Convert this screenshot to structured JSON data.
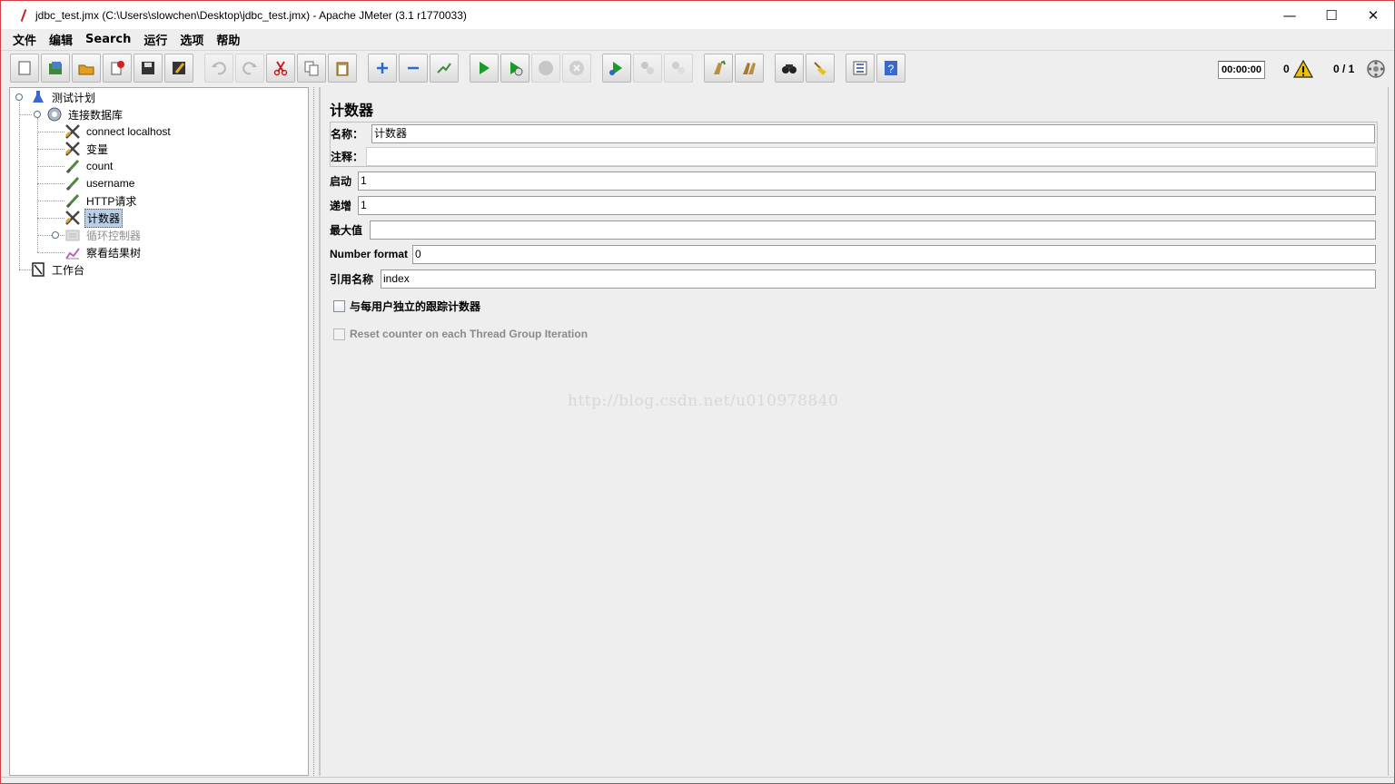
{
  "window": {
    "title": "jdbc_test.jmx (C:\\Users\\slowchen\\Desktop\\jdbc_test.jmx) - Apache JMeter (3.1 r1770033)",
    "minimize": "—",
    "maximize": "☐",
    "close": "✕"
  },
  "menu": [
    "文件",
    "编辑",
    "Search",
    "运行",
    "选项",
    "帮助"
  ],
  "toolbar": {
    "buttons": [
      {
        "icon": "new-icon",
        "enabled": true
      },
      {
        "icon": "templates-icon",
        "enabled": true
      },
      {
        "icon": "open-icon",
        "enabled": true
      },
      {
        "icon": "close-file-icon",
        "enabled": true
      },
      {
        "icon": "save-icon",
        "enabled": true
      },
      {
        "icon": "save-as-icon",
        "enabled": true
      },
      {
        "icon": "undo-icon",
        "enabled": false
      },
      {
        "icon": "redo-icon",
        "enabled": false
      },
      {
        "icon": "cut-icon",
        "enabled": true
      },
      {
        "icon": "copy-icon",
        "enabled": true
      },
      {
        "icon": "paste-icon",
        "enabled": true
      },
      {
        "icon": "expand-icon",
        "enabled": true
      },
      {
        "icon": "collapse-icon",
        "enabled": true
      },
      {
        "icon": "toggle-icon",
        "enabled": true
      },
      {
        "icon": "start-icon",
        "enabled": true
      },
      {
        "icon": "start-no-timers-icon",
        "enabled": true
      },
      {
        "icon": "stop-icon",
        "enabled": false
      },
      {
        "icon": "shutdown-icon",
        "enabled": false
      },
      {
        "icon": "remote-start-icon",
        "enabled": true
      },
      {
        "icon": "remote-stop-icon",
        "enabled": false
      },
      {
        "icon": "remote-shutdown-icon",
        "enabled": false
      },
      {
        "icon": "clear-icon",
        "enabled": true
      },
      {
        "icon": "clear-all-icon",
        "enabled": true
      },
      {
        "icon": "search-icon",
        "enabled": true
      },
      {
        "icon": "reset-search-icon",
        "enabled": true
      },
      {
        "icon": "function-helper-icon",
        "enabled": true
      },
      {
        "icon": "help-icon",
        "enabled": true
      }
    ],
    "elapsed_time": "00:00:00",
    "error_count": "0",
    "threads": "0 / 1"
  },
  "tree": [
    {
      "label": "测试计划",
      "icon": "test-plan-icon",
      "level": 0
    },
    {
      "label": "连接数据库",
      "icon": "thread-group-icon",
      "level": 1
    },
    {
      "label": "connect localhost",
      "icon": "config-element-icon",
      "level": 2
    },
    {
      "label": "变量",
      "icon": "config-element-icon",
      "level": 2
    },
    {
      "label": "count",
      "icon": "sampler-icon",
      "level": 2
    },
    {
      "label": "username",
      "icon": "sampler-icon",
      "level": 2
    },
    {
      "label": "HTTP请求",
      "icon": "sampler-icon",
      "level": 2
    },
    {
      "label": "计数器",
      "icon": "config-element-icon",
      "level": 2,
      "selected": true
    },
    {
      "label": "循环控制器",
      "icon": "controller-icon",
      "level": 2,
      "disabled": true
    },
    {
      "label": "察看结果树",
      "icon": "listener-icon",
      "level": 2
    },
    {
      "label": "工作台",
      "icon": "workbench-icon",
      "level": 0
    }
  ],
  "panel": {
    "title": "计数器",
    "name_label": "名称：",
    "name_value": "计数器",
    "comment_label": "注释：",
    "comment_value": "",
    "start_label": "启动",
    "start_value": "1",
    "increment_label": "递增",
    "increment_value": "1",
    "max_label": "最大值",
    "max_value": "",
    "format_label": "Number format",
    "format_value": "0",
    "ref_label": "引用名称",
    "ref_value": "index",
    "per_user_label": "与每用户独立的跟踪计数器",
    "per_user_checked": false,
    "reset_label": "Reset counter on each Thread Group Iteration",
    "reset_checked": false,
    "reset_enabled": false,
    "watermark": "http://blog.csdn.net/u010978840"
  }
}
